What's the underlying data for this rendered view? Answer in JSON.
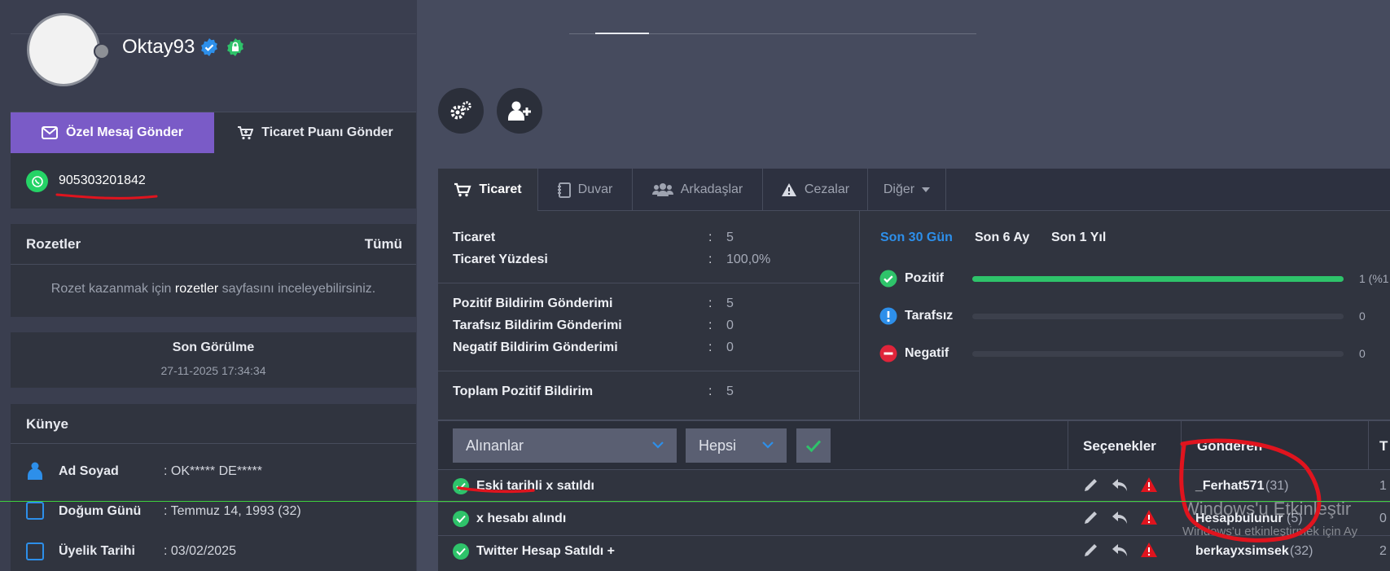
{
  "profile": {
    "username": "Oktay93",
    "phone": "905303201842",
    "send_message_label": "Özel Mesaj Gönder",
    "send_trade_label": "Ticaret Puanı Gönder"
  },
  "badges": {
    "title": "Rozetler",
    "all_link": "Tümü",
    "empty_before": "Rozet kazanmak için",
    "empty_link": "rozetler",
    "empty_after": "sayfasını inceleyebilirsiniz."
  },
  "last_seen": {
    "title": "Son Görülme",
    "value": "27-11-2025 17:34:34"
  },
  "kunye": {
    "title": "Künye",
    "items": [
      {
        "label": "Ad Soyad",
        "value": ": OK***** DE*****"
      },
      {
        "label": "Doğum Günü",
        "value": ": Temmuz 14, 1993 (32)"
      },
      {
        "label": "Üyelik Tarihi",
        "value": ": 03/02/2025"
      }
    ]
  },
  "tabs": [
    {
      "label": "Ticaret",
      "icon": "cart-icon"
    },
    {
      "label": "Duvar",
      "icon": "notebook-icon"
    },
    {
      "label": "Arkadaşlar",
      "icon": "users-icon"
    },
    {
      "label": "Cezalar",
      "icon": "warning-icon"
    },
    {
      "label": "Diğer",
      "icon": "caret-down-icon"
    }
  ],
  "stats": {
    "group1": [
      {
        "label": "Ticaret",
        "value": "5"
      },
      {
        "label": "Ticaret Yüzdesi",
        "value": "100,0%"
      }
    ],
    "group2": [
      {
        "label": "Pozitif Bildirim Gönderimi",
        "value": "5"
      },
      {
        "label": "Tarafsız Bildirim Gönderimi",
        "value": "0"
      },
      {
        "label": "Negatif Bildirim Gönderimi",
        "value": "0"
      }
    ],
    "group3": [
      {
        "label": "Toplam Pozitif Bildirim",
        "value": "5"
      }
    ],
    "colon": ":"
  },
  "periods": [
    "Son 30 Gün",
    "Son 6 Ay",
    "Son 1 Yıl"
  ],
  "ratings": [
    {
      "label": "Pozitif",
      "value": "1 (%1",
      "fill": 1.0,
      "color": "#2ec36a"
    },
    {
      "label": "Tarafsız",
      "value": "0",
      "fill": 0,
      "color": "#2d8fea"
    },
    {
      "label": "Negatif",
      "value": "0",
      "fill": 0,
      "color": "#e0243a"
    }
  ],
  "filters": {
    "type_value": "Alınanlar",
    "scope_value": "Hepsi"
  },
  "table": {
    "col_options": "Seçenekler",
    "col_sender": "Gönderen",
    "col_next": "T",
    "rows": [
      {
        "text": "Eski tarihli x satıldı",
        "sender": "_Ferhat571",
        "count": "(31)",
        "extra": "1"
      },
      {
        "text": "x hesabı alındı",
        "sender": "Hesapbulunur",
        "count": "(5)",
        "extra": "0"
      },
      {
        "text": "Twitter Hesap Satıldı +",
        "sender": "berkayxsimsek",
        "count": "(32)",
        "extra": "2"
      }
    ]
  },
  "watermark": {
    "title": "Windows'u Etkinleştir",
    "subtitle": "Windows'u etkinleştirmek için Ay"
  },
  "colors": {
    "accent_purple": "#7a5bc7",
    "accent_blue": "#2d8fea",
    "success": "#2ec36a",
    "danger": "#e0243a"
  }
}
